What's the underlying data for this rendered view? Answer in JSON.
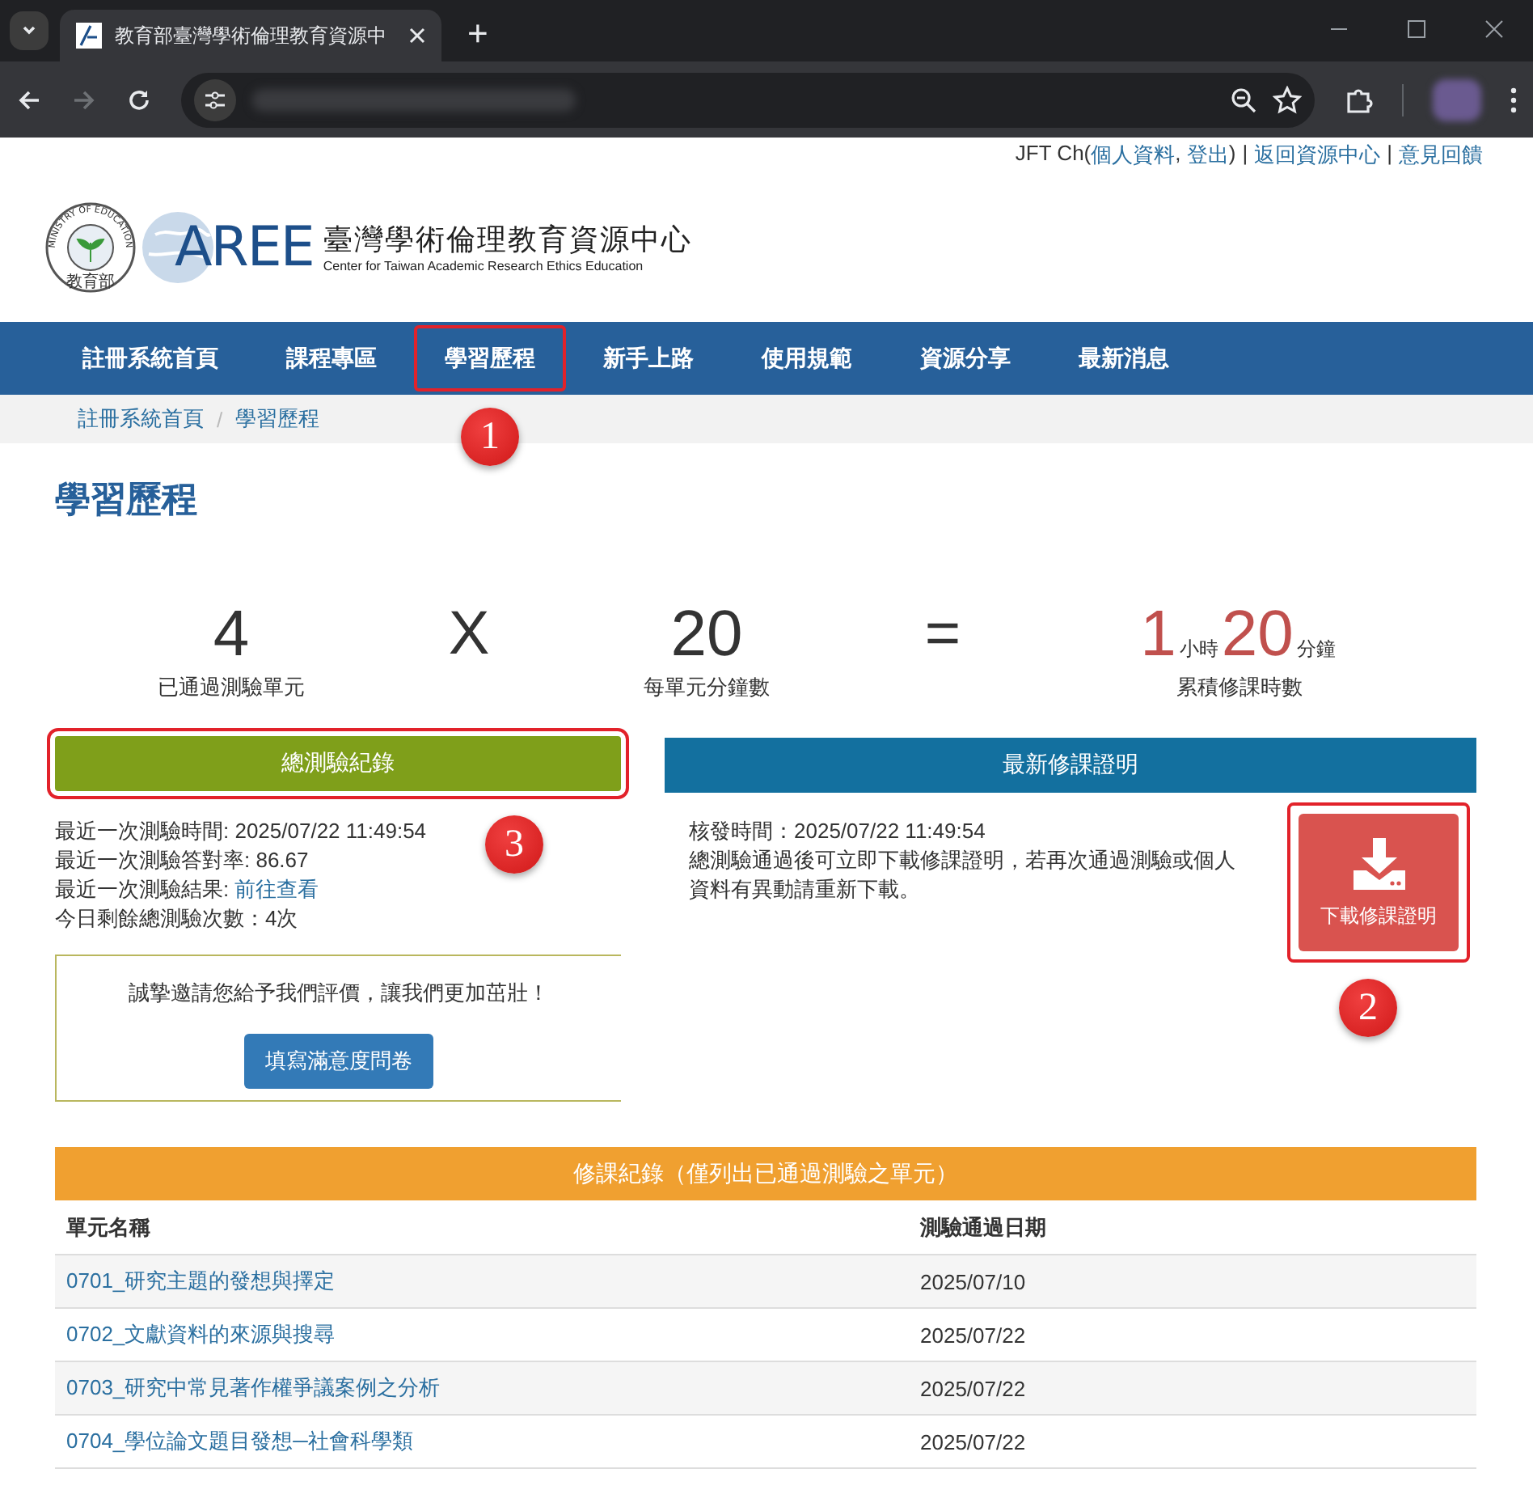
{
  "browser": {
    "tab_title": "教育部臺灣學術倫理教育資源中",
    "new_tab": "+"
  },
  "top_links": [
    {
      "kind": "text",
      "text": "JFT Ch("
    },
    {
      "kind": "link",
      "text": "個人資料"
    },
    {
      "kind": "text",
      "text": ", "
    },
    {
      "kind": "link",
      "text": "登出"
    },
    {
      "kind": "text",
      "text": ")"
    },
    {
      "kind": "separator",
      "text": "|"
    },
    {
      "kind": "link",
      "text": "返回資源中心"
    },
    {
      "kind": "separator",
      "text": "|"
    },
    {
      "kind": "link",
      "text": "意見回饋"
    }
  ],
  "logo": {
    "seal_text": "MINISTRY OF EDUCATION",
    "seal_label": "教育部",
    "mark": "AREE",
    "title": "臺灣學術倫理教育資源中心",
    "subtitle": "Center for Taiwan Academic Research Ethics Education"
  },
  "nav_items": [
    {
      "label": "註冊系統首頁",
      "highlighted": false
    },
    {
      "label": "課程專區",
      "highlighted": false
    },
    {
      "label": "學習歷程",
      "highlighted": true,
      "annotation": "1"
    },
    {
      "label": "新手上路",
      "highlighted": false
    },
    {
      "label": "使用規範",
      "highlighted": false
    },
    {
      "label": "資源分享",
      "highlighted": false
    },
    {
      "label": "最新消息",
      "highlighted": false
    }
  ],
  "breadcrumb": [
    "註冊系統首頁",
    "學習歷程"
  ],
  "breadcrumb_separator": "/",
  "page_title": "學習歷程",
  "stats": [
    {
      "kind": "number",
      "value": "4",
      "label": "已通過測驗單元"
    },
    {
      "kind": "operator",
      "value": "X"
    },
    {
      "kind": "number",
      "value": "20",
      "label": "每單元分鐘數"
    },
    {
      "kind": "operator",
      "value": "="
    },
    {
      "kind": "duration",
      "parts": [
        {
          "value": "1",
          "unit": "小時"
        },
        {
          "value": "20",
          "unit": "分鐘"
        }
      ],
      "label": "累積修課時數"
    }
  ],
  "test_panel": {
    "header": "總測驗紀錄",
    "highlighted": true,
    "annotation": "3",
    "lines": [
      {
        "text": "最近一次測驗時間: 2025/07/22 11:49:54"
      },
      {
        "text": "最近一次測驗答對率: 86.67"
      },
      {
        "text": "最近一次測驗結果: ",
        "link": "前往查看"
      },
      {
        "text": "今日剩餘總測驗次數：4次"
      }
    ],
    "survey": {
      "text": "誠摯邀請您給予我們評價，讓我們更加茁壯！",
      "button": "填寫滿意度問卷"
    }
  },
  "certificate_panel": {
    "header": "最新修課證明",
    "issued": "核發時間：2025/07/22 11:49:54",
    "note": "總測驗通過後可立即下載修課證明，若再次通過測驗或個人資料有異動請重新下載。",
    "download": {
      "label": "下載修課證明",
      "highlighted": true,
      "annotation": "2"
    }
  },
  "records": {
    "title": "修課紀錄（僅列出已通過測驗之單元）",
    "columns": [
      "單元名稱",
      "測驗通過日期"
    ],
    "rows": [
      {
        "unit": "0701_研究主題的發想與擇定",
        "date": "2025/07/10"
      },
      {
        "unit": "0702_文獻資料的來源與搜尋",
        "date": "2025/07/22"
      },
      {
        "unit": "0703_研究中常見著作權爭議案例之分析",
        "date": "2025/07/22"
      },
      {
        "unit": "0704_學位論文題目發想─社會科學類",
        "date": "2025/07/22"
      }
    ]
  }
}
